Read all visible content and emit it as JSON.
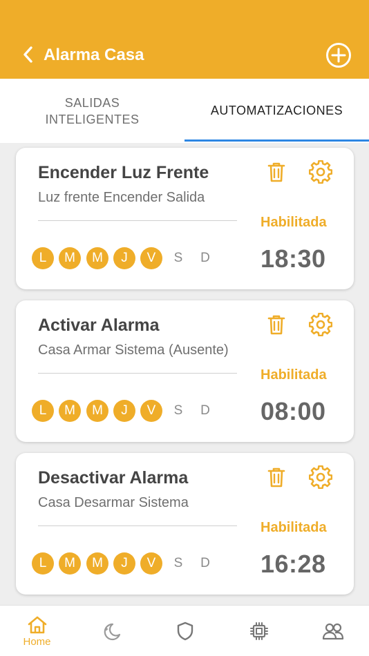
{
  "header": {
    "title": "Alarma Casa"
  },
  "tabs": [
    {
      "label": "SALIDAS\nINTELIGENTES"
    },
    {
      "label": "AUTOMATIZACIONES"
    }
  ],
  "cards": [
    {
      "title": "Encender Luz Frente",
      "subtitle": "Luz frente Encender Salida",
      "status": "Habilitada",
      "time": "18:30",
      "days": [
        {
          "label": "L",
          "active": true
        },
        {
          "label": "M",
          "active": true
        },
        {
          "label": "M",
          "active": true
        },
        {
          "label": "J",
          "active": true
        },
        {
          "label": "V",
          "active": true
        },
        {
          "label": "S",
          "active": false
        },
        {
          "label": "D",
          "active": false
        }
      ]
    },
    {
      "title": "Activar Alarma",
      "subtitle": "Casa Armar Sistema (Ausente)",
      "status": "Habilitada",
      "time": "08:00",
      "days": [
        {
          "label": "L",
          "active": true
        },
        {
          "label": "M",
          "active": true
        },
        {
          "label": "M",
          "active": true
        },
        {
          "label": "J",
          "active": true
        },
        {
          "label": "V",
          "active": true
        },
        {
          "label": "S",
          "active": false
        },
        {
          "label": "D",
          "active": false
        }
      ]
    },
    {
      "title": "Desactivar Alarma",
      "subtitle": "Casa Desarmar Sistema",
      "status": "Habilitada",
      "time": "16:28",
      "days": [
        {
          "label": "L",
          "active": true
        },
        {
          "label": "M",
          "active": true
        },
        {
          "label": "M",
          "active": true
        },
        {
          "label": "J",
          "active": true
        },
        {
          "label": "V",
          "active": true
        },
        {
          "label": "S",
          "active": false
        },
        {
          "label": "D",
          "active": false
        }
      ]
    }
  ],
  "bottom_nav": [
    {
      "icon": "home-icon",
      "label": "Home",
      "active": true
    },
    {
      "icon": "moon-icon",
      "label": "",
      "active": false
    },
    {
      "icon": "shield-icon",
      "label": "",
      "active": false
    },
    {
      "icon": "chip-icon",
      "label": "",
      "active": false
    },
    {
      "icon": "users-icon",
      "label": "",
      "active": false
    }
  ],
  "colors": {
    "primary": "#efad29",
    "tab_indicator": "#2d86e3",
    "background": "#eeeeee",
    "card": "#ffffff"
  }
}
